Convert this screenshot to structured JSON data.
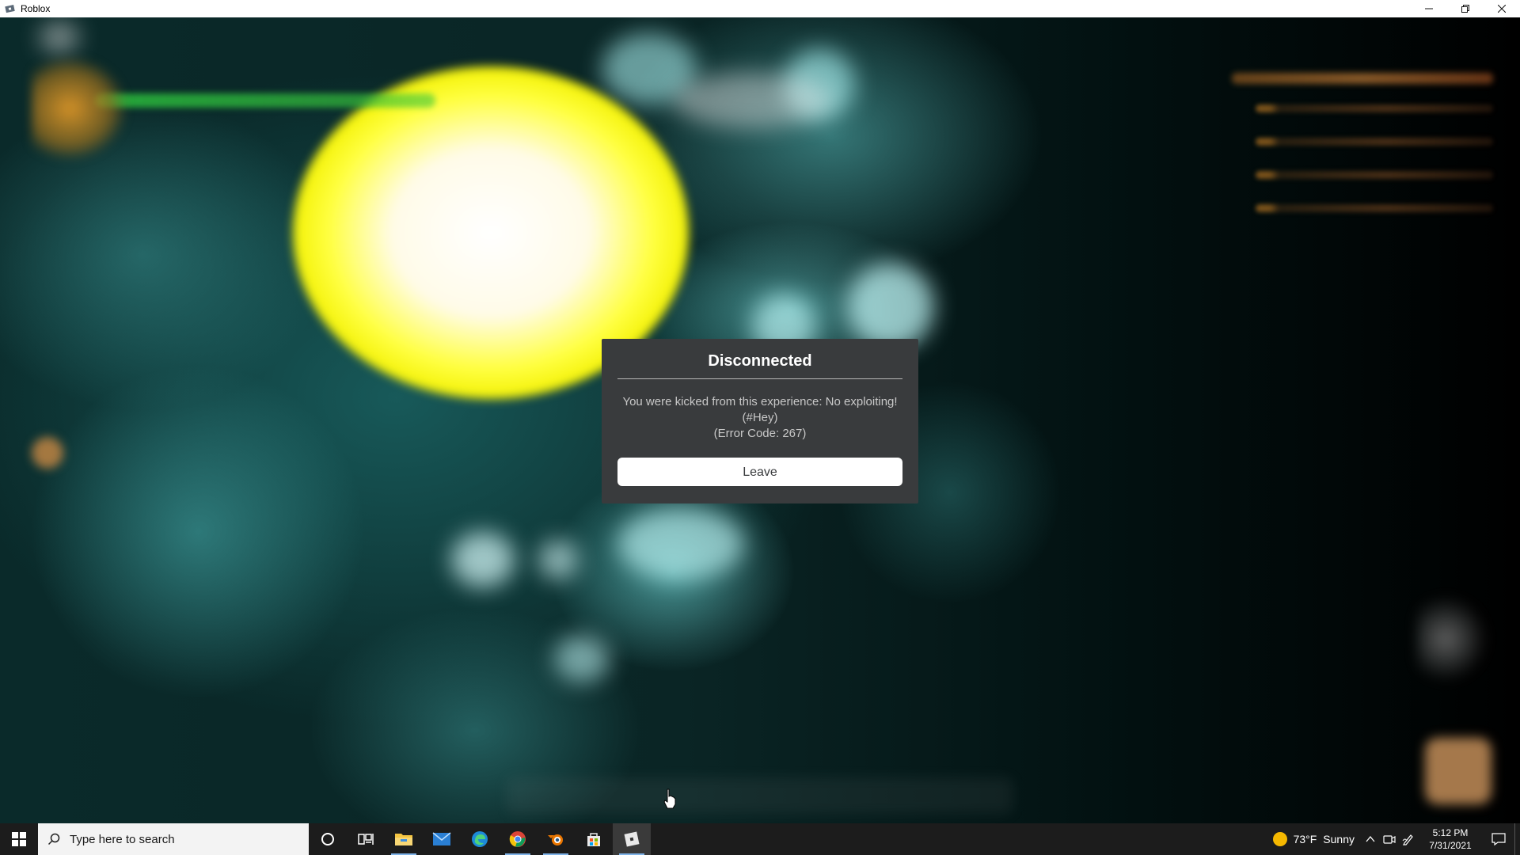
{
  "window": {
    "title": "Roblox",
    "icon": "roblox-icon",
    "controls": [
      "minimize-icon",
      "restore-icon",
      "close-icon"
    ]
  },
  "dialog": {
    "title": "Disconnected",
    "message_line1": "You were kicked from this experience: No exploiting!",
    "message_line2": "(#Hey)",
    "message_line3": "(Error Code: 267)",
    "leave_label": "Leave",
    "colors": {
      "background": "#393b3d",
      "title": "#ffffff",
      "text": "#c8c8c8",
      "button_bg": "#ffffff",
      "button_text": "#393b3d"
    }
  },
  "taskbar": {
    "search_placeholder": "Type here to search",
    "pinned_apps": [
      {
        "name": "cortana-icon"
      },
      {
        "name": "task-view-icon"
      },
      {
        "name": "file-explorer-icon"
      },
      {
        "name": "mail-icon"
      },
      {
        "name": "edge-icon"
      },
      {
        "name": "chrome-icon"
      },
      {
        "name": "blender-icon"
      },
      {
        "name": "microsoft-store-icon"
      },
      {
        "name": "roblox-icon"
      }
    ],
    "weather": {
      "temp": "73°F",
      "condition": "Sunny"
    },
    "clock": {
      "time": "5:12 PM",
      "date": "7/31/2021"
    }
  }
}
